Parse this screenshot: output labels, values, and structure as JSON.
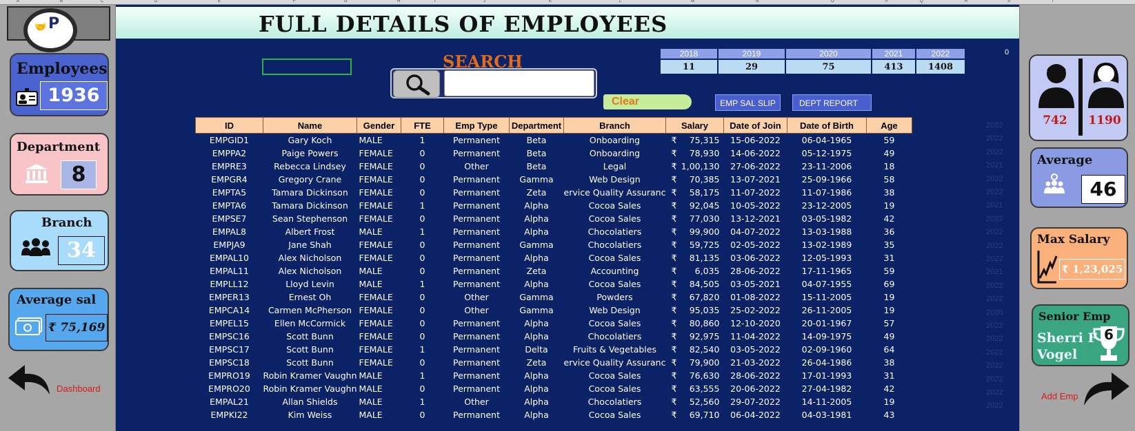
{
  "title": "FULL DETAILS OF EMPLOYEES",
  "column_letters": [
    "A",
    "B",
    "C",
    "D",
    "E",
    "F",
    "G",
    "H",
    "I",
    "J",
    "K",
    "L",
    "M",
    "N",
    "O",
    "P",
    "Q",
    "R",
    "S",
    "T"
  ],
  "search": {
    "label": "SEARCH",
    "value": ""
  },
  "buttons": {
    "clear": "Clear",
    "emp_sal_slip": "EMP SAL SLIP",
    "dept_report": "DEPT REPORT"
  },
  "year_counts": {
    "years": [
      "2018",
      "2019",
      "2020",
      "2021",
      "2022"
    ],
    "counts": [
      "11",
      "29",
      "75",
      "413",
      "1408"
    ]
  },
  "corner_zero": "0",
  "left_cards": {
    "employees": {
      "title": "Employees",
      "value": "1936"
    },
    "department": {
      "title": "Department",
      "value": "8"
    },
    "branch": {
      "title": "Branch",
      "value": "34"
    },
    "average_sal": {
      "title": "Average sal",
      "value": "₹ 75,169"
    },
    "nav_dashboard": "Dashboard"
  },
  "right_cards": {
    "gender": {
      "male": "742",
      "female": "1190"
    },
    "average": {
      "title": "Average",
      "value": "46"
    },
    "max_salary": {
      "title": "Max Salary",
      "value": "₹ 1,23,025"
    },
    "senior_emp": {
      "title": "Senior Emp",
      "name_line1": "Sherri F",
      "name_line2": "Vogel",
      "value": "6"
    },
    "nav_add_emp": "Add Emp"
  },
  "table": {
    "headers": [
      "ID",
      "Name",
      "Gender",
      "FTE",
      "Emp Type",
      "Department",
      "Branch",
      "Salary",
      "Date of Join",
      "Date of Birth",
      "Age"
    ],
    "rows": [
      [
        "EMPGID1",
        "Gary Koch",
        "MALE",
        "1",
        "Permanent",
        "Beta",
        "Onboarding",
        "75,315",
        "15-06-2022",
        "06-04-1965",
        "59"
      ],
      [
        "EMPPA2",
        "Paige Powers",
        "FEMALE",
        "0",
        "Permanent",
        "Beta",
        "Onboarding",
        "78,930",
        "14-06-2022",
        "05-12-1975",
        "49"
      ],
      [
        "EMPRE3",
        "Rebecca Lindsey",
        "FEMALE",
        "0",
        "Other",
        "Beta",
        "Legal",
        "1,00,130",
        "27-06-2022",
        "23-11-2006",
        "18"
      ],
      [
        "EMPGR4",
        "Gregory Crane",
        "FEMALE",
        "0",
        "Permanent",
        "Gamma",
        "Web Design",
        "70,385",
        "13-07-2021",
        "25-09-1966",
        "58"
      ],
      [
        "EMPTA5",
        "Tamara Dickinson",
        "FEMALE",
        "0",
        "Permanent",
        "Zeta",
        "ervice Quality Assuranc",
        "58,175",
        "11-07-2022",
        "11-07-1986",
        "38"
      ],
      [
        "EMPTA6",
        "Tamara Dickinson",
        "FEMALE",
        "1",
        "Permanent",
        "Alpha",
        "Cocoa Sales",
        "92,045",
        "10-05-2022",
        "23-12-2005",
        "19"
      ],
      [
        "EMPSE7",
        "Sean Stephenson",
        "FEMALE",
        "0",
        "Permanent",
        "Alpha",
        "Cocoa Sales",
        "77,030",
        "13-12-2021",
        "03-05-1982",
        "42"
      ],
      [
        "EMPAL8",
        "Albert Frost",
        "MALE",
        "1",
        "Permanent",
        "Alpha",
        "Chocolatiers",
        "99,900",
        "04-07-2022",
        "13-03-1988",
        "36"
      ],
      [
        "EMPJA9",
        "Jane Shah",
        "FEMALE",
        "0",
        "Permanent",
        "Gamma",
        "Chocolatiers",
        "59,725",
        "02-05-2022",
        "13-02-1989",
        "35"
      ],
      [
        "EMPAL10",
        "Alex Nicholson",
        "FEMALE",
        "0",
        "Permanent",
        "Alpha",
        "Cocoa Sales",
        "81,135",
        "03-06-2022",
        "12-05-1993",
        "31"
      ],
      [
        "EMPAL11",
        "Alex Nicholson",
        "MALE",
        "0",
        "Permanent",
        "Zeta",
        "Accounting",
        "6,035",
        "28-06-2022",
        "17-11-1965",
        "59"
      ],
      [
        "EMPLL12",
        "Lloyd Levin",
        "MALE",
        "1",
        "Permanent",
        "Alpha",
        "Cocoa Sales",
        "84,505",
        "03-05-2021",
        "04-07-1955",
        "69"
      ],
      [
        "EMPER13",
        "Ernest Oh",
        "FEMALE",
        "0",
        "Other",
        "Gamma",
        "Powders",
        "67,820",
        "01-08-2022",
        "15-11-2005",
        "19"
      ],
      [
        "EMPCA14",
        "Carmen McPherson",
        "FEMALE",
        "0",
        "Other",
        "Gamma",
        "Web Design",
        "95,035",
        "25-02-2022",
        "26-11-2005",
        "19"
      ],
      [
        "EMPEL15",
        "Ellen McCormick",
        "FEMALE",
        "0",
        "Permanent",
        "Alpha",
        "Cocoa Sales",
        "80,860",
        "12-10-2020",
        "20-01-1967",
        "57"
      ],
      [
        "EMPSC16",
        "Scott Bunn",
        "FEMALE",
        "0",
        "Permanent",
        "Alpha",
        "Chocolatiers",
        "92,975",
        "11-04-2022",
        "14-09-1975",
        "49"
      ],
      [
        "EMPSC17",
        "Scott Bunn",
        "FEMALE",
        "1",
        "Permanent",
        "Delta",
        "Fruits & Vegetables",
        "82,540",
        "03-05-2022",
        "02-09-1960",
        "64"
      ],
      [
        "EMPSC18",
        "Scott Bunn",
        "FEMALE",
        "0",
        "Permanent",
        "Zeta",
        "ervice Quality Assuranc",
        "79,900",
        "21-03-2022",
        "26-04-1986",
        "38"
      ],
      [
        "EMPRO19",
        "Robin Kramer Vaughn",
        "MALE",
        "1",
        "Permanent",
        "Alpha",
        "Cocoa Sales",
        "76,630",
        "28-06-2022",
        "17-01-1993",
        "31"
      ],
      [
        "EMPRO20",
        "Robin Kramer Vaughn",
        "MALE",
        "0",
        "Permanent",
        "Alpha",
        "Cocoa Sales",
        "63,555",
        "20-06-2022",
        "27-04-1982",
        "42"
      ],
      [
        "EMPAL21",
        "Allan Shields",
        "MALE",
        "1",
        "Other",
        "Alpha",
        "Chocolatiers",
        "52,560",
        "29-07-2022",
        "14-11-2005",
        "19"
      ],
      [
        "EMPKI22",
        "Kim Weiss",
        "MALE",
        "0",
        "Permanent",
        "Alpha",
        "Cocoa Sales",
        "69,710",
        "06-04-2022",
        "04-03-1981",
        "43"
      ]
    ],
    "currency": "₹"
  },
  "ghost_years": [
    "2022",
    "2022",
    "2022",
    "2021",
    "2022",
    "2022",
    "2021",
    "2022",
    "2022",
    "2022",
    "2022",
    "2021",
    "2022",
    "2022",
    "2020",
    "2022",
    "2022",
    "2022",
    "2022",
    "2022",
    "2022",
    "2022"
  ]
}
